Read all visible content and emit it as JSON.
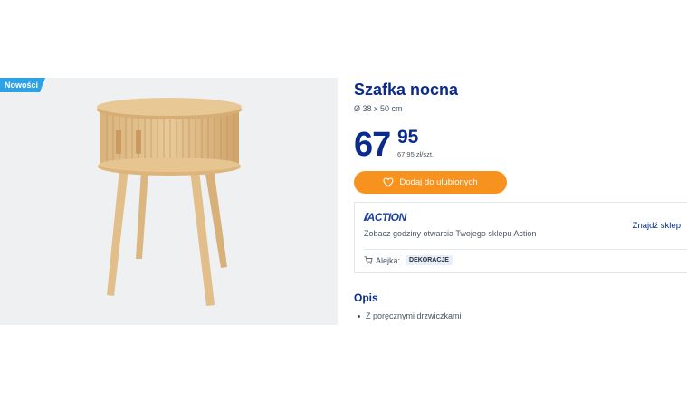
{
  "image": {
    "badge": "Nowości",
    "alt_icon": "bedside-table-image"
  },
  "product": {
    "title": "Szafka nocna",
    "dimensions": "Ø 38 x 50 cm",
    "price_integer": "67",
    "price_decimals": "95",
    "unit_price": "67,95 zł/szt.",
    "favorite_button": "Dodaj do ulubionych"
  },
  "store": {
    "logo": "ACTION",
    "find_store": "Znajdź sklep",
    "hours_text": "Zobacz godziny otwarcia Twojego sklepu Action",
    "aisle_label": "Alejka:",
    "aisle_value": "DEKORACJE"
  },
  "description": {
    "heading": "Opis",
    "features": [
      "Z poręcznymi drzwiczkami"
    ]
  },
  "colors": {
    "brand_blue": "#0a2a8c",
    "button_orange": "#f7921e",
    "badge_blue": "#2ea2e6"
  }
}
